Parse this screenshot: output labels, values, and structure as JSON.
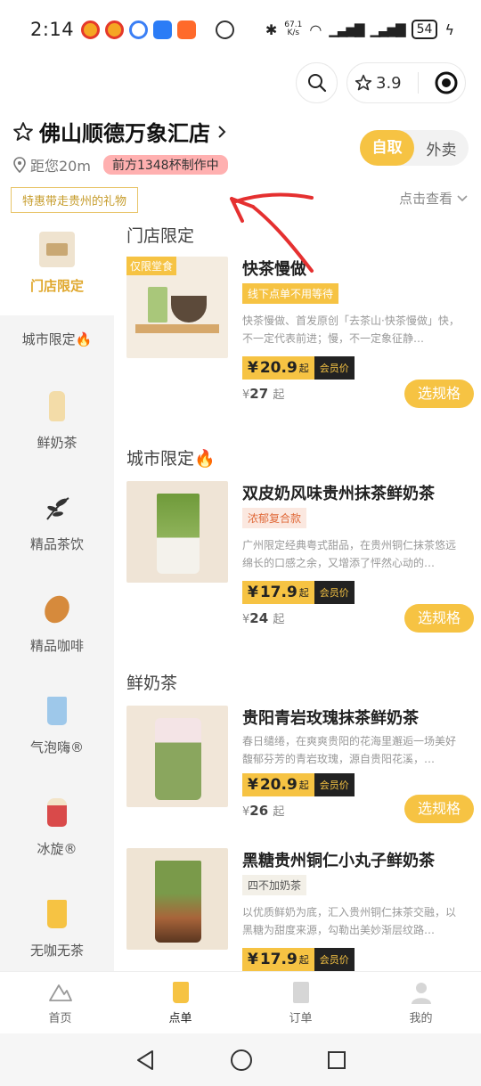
{
  "status_bar": {
    "time": "2:14",
    "net_speed_value": "67.1",
    "net_speed_unit": "K/s",
    "battery": "54"
  },
  "topbar": {
    "rating": "3.9"
  },
  "store": {
    "name": "佛山顺德万象汇店",
    "distance": "距您20m",
    "queue": "前方1348杯制作中",
    "mode_pickup": "自取",
    "mode_delivery": "外卖",
    "promo": "特惠带走贵州的礼物",
    "view_all": "点击查看"
  },
  "sidebar": {
    "items": [
      {
        "label": "门店限定"
      },
      {
        "label": "城市限定🔥"
      },
      {
        "label": "鲜奶茶"
      },
      {
        "label": "精品茶饮"
      },
      {
        "label": "精品咖啡"
      },
      {
        "label": "气泡嗨®"
      },
      {
        "label": "冰旋®"
      },
      {
        "label": "无咖无茶"
      }
    ]
  },
  "sections": [
    {
      "title": "门店限定"
    },
    {
      "title": "城市限定🔥"
    },
    {
      "title": "鲜奶茶"
    }
  ],
  "products": [
    {
      "corner": "仅限堂食",
      "name": "快茶慢做",
      "tag": "线下点单不用等待",
      "desc": "快茶慢做、首发原创「去茶山·快茶慢做」快，不一定代表前进；慢，不一定象征静…",
      "price": "20.9",
      "price_suffix": "起",
      "member_label": "会员价",
      "orig_price": "27",
      "orig_suffix": "起",
      "button": "选规格"
    },
    {
      "name": "双皮奶风味贵州抹茶鲜奶茶",
      "tag": "浓郁复合款",
      "desc": "广州限定经典粤式甜品，在贵州铜仁抹茶悠远绵长的口感之余，又增添了怦然心动的…",
      "price": "17.9",
      "price_suffix": "起",
      "member_label": "会员价",
      "orig_price": "24",
      "orig_suffix": "起",
      "button": "选规格"
    },
    {
      "name": "贵阳青岩玫瑰抹茶鲜奶茶",
      "desc": "春日缱绻，在爽爽贵阳的花海里邂逅一场美好 馥郁芬芳的青岩玫瑰，源自贵阳花溪，…",
      "price": "20.9",
      "price_suffix": "起",
      "member_label": "会员价",
      "orig_price": "26",
      "orig_suffix": "起",
      "button": "选规格"
    },
    {
      "name": "黑糖贵州铜仁小丸子鲜奶茶",
      "tag": "四不加奶茶",
      "desc": "以优质鲜奶为底，汇入贵州铜仁抹茶交融，以黑糖为甜度来源，勾勒出美妙渐层纹路…",
      "price": "17.9",
      "price_suffix": "起",
      "member_label": "会员价"
    }
  ],
  "currency": "¥",
  "tabbar": {
    "items": [
      {
        "label": "首页"
      },
      {
        "label": "点单"
      },
      {
        "label": "订单"
      },
      {
        "label": "我的"
      }
    ]
  },
  "colors": {
    "accent": "#f6c343",
    "member_bg": "#222222",
    "annotation": "#e53030"
  }
}
